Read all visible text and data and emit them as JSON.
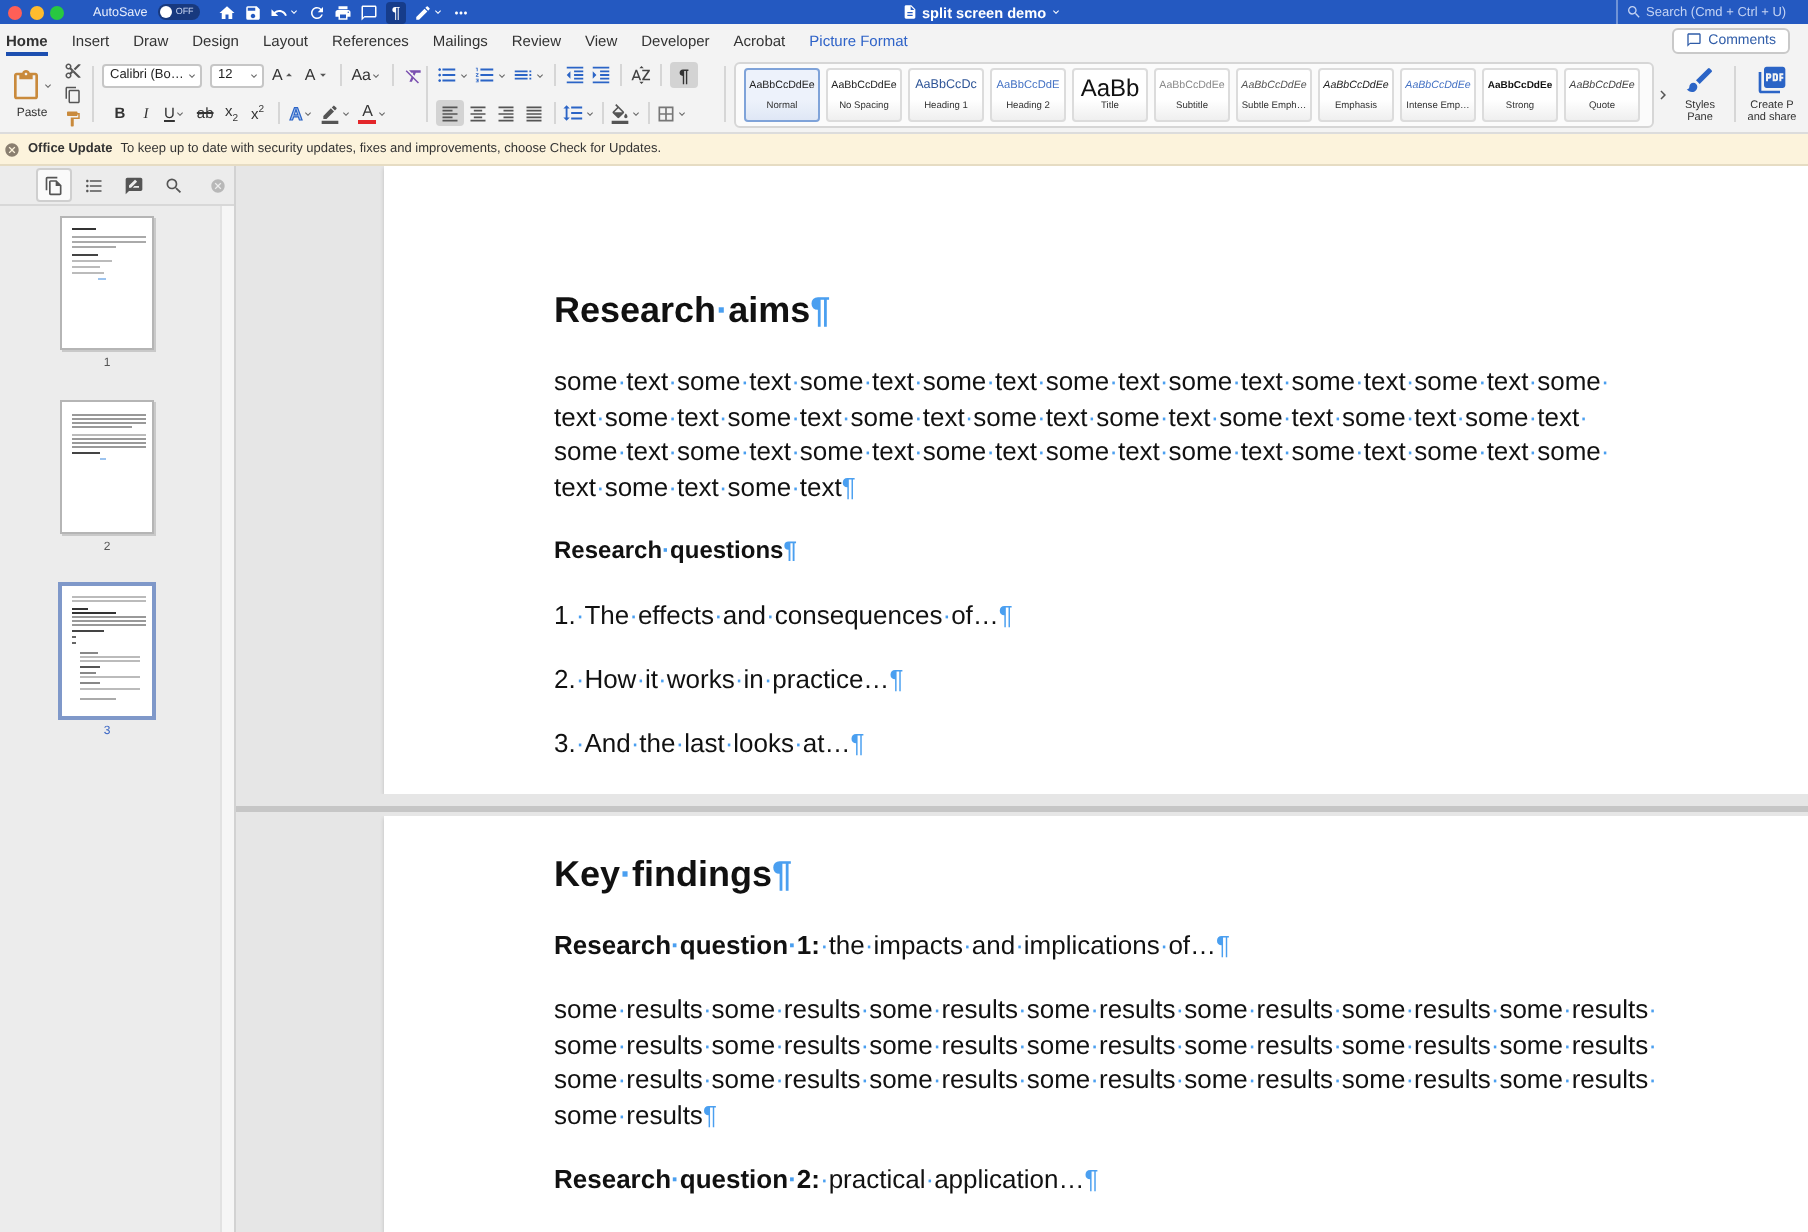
{
  "title_bar": {
    "autosave": {
      "label": "AutoSave",
      "on": false,
      "state_label": "OFF"
    },
    "show_marks": {
      "label": "¶",
      "on": true
    },
    "document_title": "split screen demo",
    "search": {
      "placeholder": "Search (Cmd + Ctrl + U)"
    }
  },
  "tabs": [
    {
      "label": "Home",
      "kind": "standard",
      "selected": true
    },
    {
      "label": "Insert",
      "kind": "standard",
      "selected": false
    },
    {
      "label": "Draw",
      "kind": "standard",
      "selected": false
    },
    {
      "label": "Design",
      "kind": "standard",
      "selected": false
    },
    {
      "label": "Layout",
      "kind": "standard",
      "selected": false
    },
    {
      "label": "References",
      "kind": "standard",
      "selected": false
    },
    {
      "label": "Mailings",
      "kind": "standard",
      "selected": false
    },
    {
      "label": "Review",
      "kind": "standard",
      "selected": false
    },
    {
      "label": "View",
      "kind": "standard",
      "selected": false
    },
    {
      "label": "Developer",
      "kind": "standard",
      "selected": false
    },
    {
      "label": "Acrobat",
      "kind": "standard",
      "selected": false
    },
    {
      "label": "Picture Format",
      "kind": "contextual",
      "selected": false
    }
  ],
  "comments_button": {
    "label": "Comments"
  },
  "ribbon": {
    "paste": {
      "label": "Paste"
    },
    "font_name": {
      "value": "Calibri (Bo…"
    },
    "font_size": {
      "value": "12"
    },
    "size_buttons": [
      {
        "kind": "grow",
        "label": "A"
      },
      {
        "kind": "shrink",
        "label": "A"
      }
    ],
    "change_case": {
      "label": "Aa"
    },
    "format_buttons": [
      {
        "kind": "bold",
        "label": "B"
      },
      {
        "kind": "italic",
        "label": "I"
      },
      {
        "kind": "underline",
        "label": "U"
      },
      {
        "kind": "strikethrough",
        "label": "ab"
      },
      {
        "kind": "subscript",
        "label": "x$_{2}$"
      },
      {
        "kind": "superscript",
        "label": "x$^{2}$"
      }
    ],
    "text_effects": {
      "label": "A"
    },
    "font_color": {
      "label": "A",
      "color": "#e3262a"
    },
    "show_marks": {
      "label": "¶",
      "selected": true
    },
    "alignment": [
      {
        "kind": "left",
        "selected": true
      },
      {
        "kind": "center",
        "selected": false
      },
      {
        "kind": "right",
        "selected": false
      },
      {
        "kind": "justify",
        "selected": false
      }
    ],
    "styles": [
      {
        "kind": "normal",
        "preview": "AaBbCcDdEe",
        "label": "Normal",
        "selected": true
      },
      {
        "kind": "no_spacing",
        "preview": "AaBbCcDdEe",
        "label": "No Spacing",
        "selected": false
      },
      {
        "kind": "heading1",
        "preview": "AaBbCcDc",
        "label": "Heading 1",
        "selected": false
      },
      {
        "kind": "heading2",
        "preview": "AaBbCcDdE",
        "label": "Heading 2",
        "selected": false
      },
      {
        "kind": "title",
        "preview": "AaBb",
        "label": "Title",
        "selected": false
      },
      {
        "kind": "subtitle",
        "preview": "AaBbCcDdEe",
        "label": "Subtitle",
        "selected": false
      },
      {
        "kind": "subtle_emphasis",
        "preview": "AaBbCcDdEe",
        "label": "Subtle Emph…",
        "selected": false
      },
      {
        "kind": "emphasis",
        "preview": "AaBbCcDdEe",
        "label": "Emphasis",
        "selected": false
      },
      {
        "kind": "intense_emphasis",
        "preview": "AaBbCcDdEe",
        "label": "Intense Emp…",
        "selected": false
      },
      {
        "kind": "strong",
        "preview": "AaBbCcDdEe",
        "label": "Strong",
        "selected": false
      },
      {
        "kind": "quote",
        "preview": "AaBbCcDdEe",
        "label": "Quote",
        "selected": false
      }
    ],
    "styles_pane": {
      "label": "Styles Pane"
    },
    "create_pdf": {
      "label": "Create P and share"
    }
  },
  "update_bar": {
    "title": "Office Update",
    "message": "To keep up to date with security updates, fixes and improvements, choose Check for Updates."
  },
  "sidebar": {
    "tabs": [
      {
        "kind": "thumbnails",
        "selected": true
      },
      {
        "kind": "outline",
        "selected": false
      },
      {
        "kind": "changes",
        "selected": false
      },
      {
        "kind": "search",
        "selected": false
      }
    ],
    "pages": [
      {
        "number": "1",
        "selected": false
      },
      {
        "number": "2",
        "selected": false
      },
      {
        "number": "3",
        "selected": true
      }
    ]
  },
  "document": {
    "panes": [
      {
        "paragraphs": [
          {
            "kind": "heading",
            "text": "Research·aims¶"
          },
          {
            "kind": "body",
            "text": "some·text·some·text·some·text·some·text·some·text·some·text·some·text·some·text·some·text·some·text·some·text·some·text·some·text·some·text·some·text·some·text·some·text·some·text·some·text·some·text·some·text·some·text·some·text·some·text·some·text·some·text·some·text·some·text¶"
          },
          {
            "kind": "subheading",
            "text": "Research·questions¶"
          },
          {
            "kind": "body",
            "text": "1.·The·effects·and·consequences·of…¶"
          },
          {
            "kind": "body",
            "text": "2.·How·it·works·in·practice…¶"
          },
          {
            "kind": "body",
            "text": "3.·And·the·last·looks·at…¶"
          }
        ]
      },
      {
        "paragraphs": [
          {
            "kind": "heading",
            "text": "Key·findings¶"
          },
          {
            "kind": "body",
            "text": "**Research·question·1:**·the·impacts·and·implications·of…¶"
          },
          {
            "kind": "body",
            "text": "some·results·some·results·some·results·some·results·some·results·some·results·some·results·some·results·some·results·some·results·some·results·some·results·some·results·some·results·some·results·some·results·some·results·some·results·some·results·some·results·some·results·some·results¶"
          },
          {
            "kind": "body",
            "text": "**Research·question·2:**·practical·application…¶"
          }
        ]
      }
    ]
  }
}
